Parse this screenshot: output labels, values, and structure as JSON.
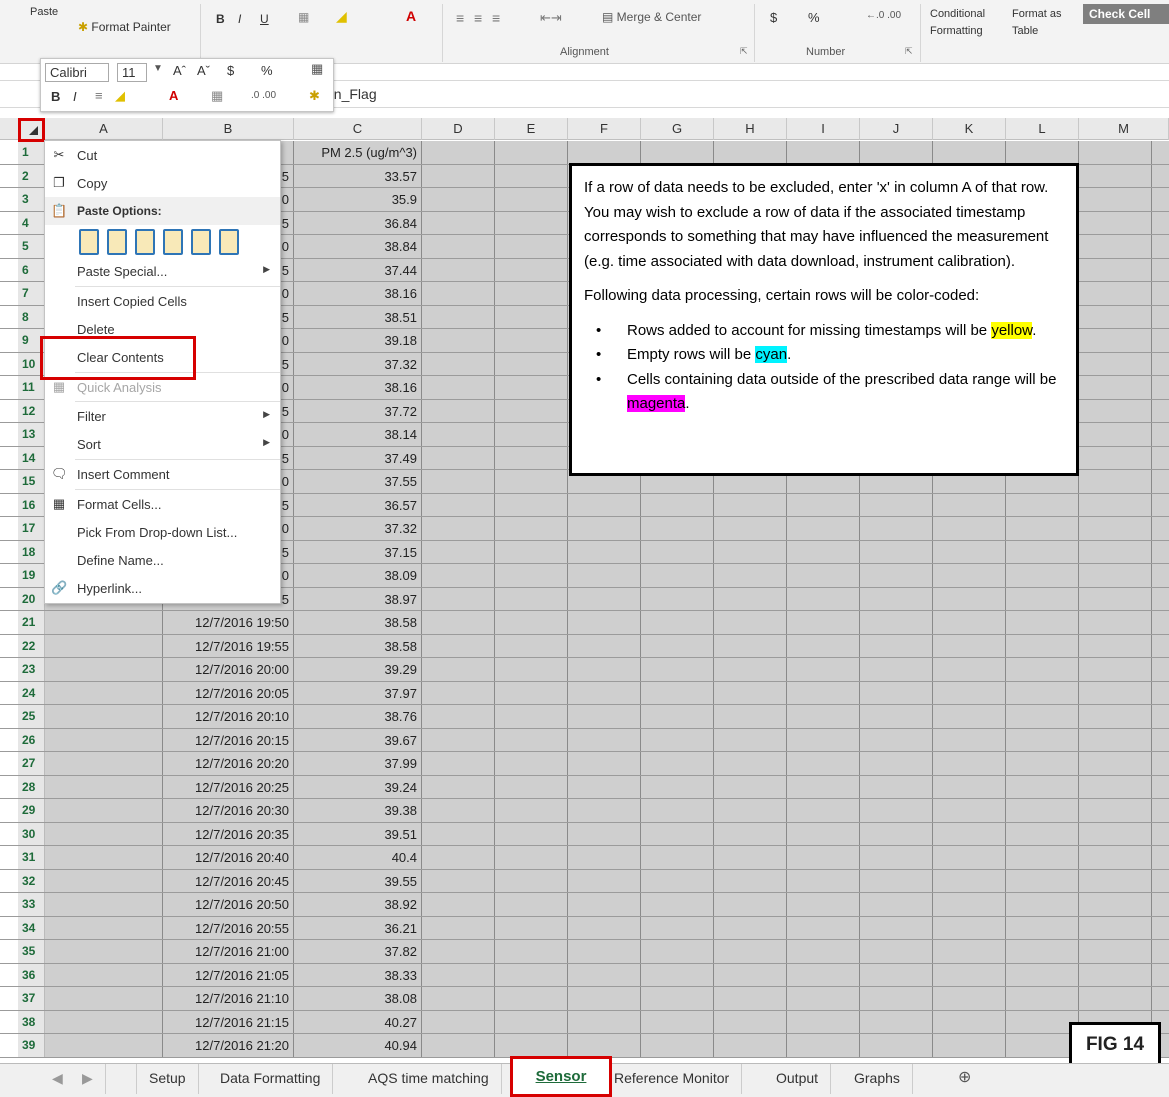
{
  "ribbon": {
    "paste": "Paste",
    "format_painter": "Format Painter",
    "merge_center": "Merge & Center",
    "alignment": "Alignment",
    "number": "Number",
    "conditional_formatting": "Conditional Formatting",
    "format_as_table": "Format as Table",
    "check_cell": "Check Cell",
    "font_bold": "B",
    "font_italic": "I",
    "font_underline": "U",
    "currency": "$",
    "percent": "%"
  },
  "mini_toolbar": {
    "font": "Calibri",
    "size": "11",
    "currency": "$",
    "percent": "%",
    "bold": "B",
    "italic": "I"
  },
  "formula_bar": {
    "value": "clusion_Flag"
  },
  "columns": [
    "A",
    "B",
    "C",
    "D",
    "E",
    "F",
    "G",
    "H",
    "I",
    "J",
    "K",
    "L",
    "M"
  ],
  "header_row": {
    "c": "PM 2.5 (ug/m^3)"
  },
  "rows": [
    {
      "n": "1",
      "b": "",
      "c": "PM 2.5 (ug/m^3)"
    },
    {
      "n": "2",
      "b": "5",
      "c": "33.57"
    },
    {
      "n": "3",
      "b": "0",
      "c": "35.9"
    },
    {
      "n": "4",
      "b": "5",
      "c": "36.84"
    },
    {
      "n": "5",
      "b": "0",
      "c": "38.84"
    },
    {
      "n": "6",
      "b": "5",
      "c": "37.44"
    },
    {
      "n": "7",
      "b": "0",
      "c": "38.16"
    },
    {
      "n": "8",
      "b": "5",
      "c": "38.51"
    },
    {
      "n": "9",
      "b": "0",
      "c": "39.18"
    },
    {
      "n": "10",
      "b": "5",
      "c": "37.32"
    },
    {
      "n": "11",
      "b": "0",
      "c": "38.16"
    },
    {
      "n": "12",
      "b": "5",
      "c": "37.72"
    },
    {
      "n": "13",
      "b": "0",
      "c": "38.14"
    },
    {
      "n": "14",
      "b": "5",
      "c": "37.49"
    },
    {
      "n": "15",
      "b": "0",
      "c": "37.55"
    },
    {
      "n": "16",
      "b": "5",
      "c": "36.57"
    },
    {
      "n": "17",
      "b": "0",
      "c": "37.32"
    },
    {
      "n": "18",
      "b": "5",
      "c": "37.15"
    },
    {
      "n": "19",
      "b": "0",
      "c": "38.09"
    },
    {
      "n": "20",
      "b": "5",
      "c": "38.97"
    },
    {
      "n": "21",
      "b": "12/7/2016 19:50",
      "c": "38.58"
    },
    {
      "n": "22",
      "b": "12/7/2016 19:55",
      "c": "38.58"
    },
    {
      "n": "23",
      "b": "12/7/2016 20:00",
      "c": "39.29"
    },
    {
      "n": "24",
      "b": "12/7/2016 20:05",
      "c": "37.97"
    },
    {
      "n": "25",
      "b": "12/7/2016 20:10",
      "c": "38.76"
    },
    {
      "n": "26",
      "b": "12/7/2016 20:15",
      "c": "39.67"
    },
    {
      "n": "27",
      "b": "12/7/2016 20:20",
      "c": "37.99"
    },
    {
      "n": "28",
      "b": "12/7/2016 20:25",
      "c": "39.24"
    },
    {
      "n": "29",
      "b": "12/7/2016 20:30",
      "c": "39.38"
    },
    {
      "n": "30",
      "b": "12/7/2016 20:35",
      "c": "39.51"
    },
    {
      "n": "31",
      "b": "12/7/2016 20:40",
      "c": "40.4"
    },
    {
      "n": "32",
      "b": "12/7/2016 20:45",
      "c": "39.55"
    },
    {
      "n": "33",
      "b": "12/7/2016 20:50",
      "c": "38.92"
    },
    {
      "n": "34",
      "b": "12/7/2016 20:55",
      "c": "36.21"
    },
    {
      "n": "35",
      "b": "12/7/2016 21:00",
      "c": "37.82"
    },
    {
      "n": "36",
      "b": "12/7/2016 21:05",
      "c": "38.33"
    },
    {
      "n": "37",
      "b": "12/7/2016 21:10",
      "c": "38.08"
    },
    {
      "n": "38",
      "b": "12/7/2016 21:15",
      "c": "40.27"
    },
    {
      "n": "39",
      "b": "12/7/2016 21:20",
      "c": "40.94"
    }
  ],
  "context_menu": {
    "cut": "Cut",
    "copy": "Copy",
    "paste_options": "Paste Options:",
    "paste_special": "Paste Special...",
    "insert_copied": "Insert Copied Cells",
    "delete": "Delete",
    "clear_contents": "Clear Contents",
    "quick_analysis": "Quick Analysis",
    "filter": "Filter",
    "sort": "Sort",
    "insert_comment": "Insert Comment",
    "format_cells": "Format Cells...",
    "pick_list": "Pick From Drop-down List...",
    "define_name": "Define Name...",
    "hyperlink": "Hyperlink..."
  },
  "info": {
    "p1": "If a row of data needs to be excluded, enter 'x' in column A of that row.  You may wish to exclude a row of data if the associated timestamp corresponds to something that may have influenced the measurement (e.g. time associated with data download, instrument calibration).",
    "p2": "Following data processing, certain rows will be color-coded:",
    "b1_pre": "Rows added to account for missing timestamps will be ",
    "b1_hl": "yellow",
    "b2_pre": "Empty rows will be ",
    "b2_hl": "cyan",
    "b3_pre": "Cells containing data outside of the prescribed data range will be ",
    "b3_hl": "magenta",
    "dot": "."
  },
  "fig_label": "FIG 14",
  "tabs": [
    "Setup",
    "Data Formatting",
    "AQS time matching",
    "Sensor",
    "Reference Monitor",
    "Output",
    "Graphs"
  ],
  "colors": {
    "accent_red": "#d60000",
    "excel_green": "#1e6b3a",
    "yellow": "#ffff00",
    "cyan": "#00f3ff",
    "magenta": "#ff00ff"
  }
}
